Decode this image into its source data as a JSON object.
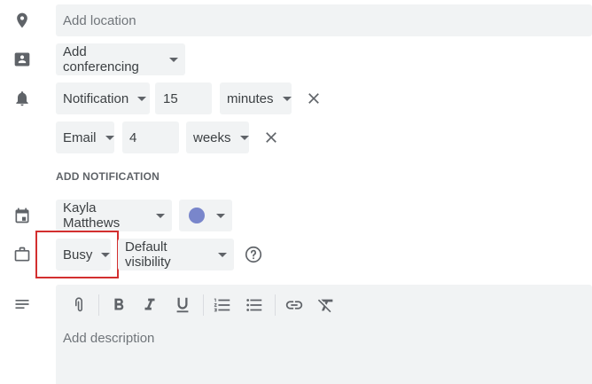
{
  "location": {
    "placeholder": "Add location"
  },
  "conferencing": {
    "label": "Add conferencing"
  },
  "notifications": [
    {
      "method": "Notification",
      "amount": "15",
      "unit": "minutes"
    },
    {
      "method": "Email",
      "amount": "4",
      "unit": "weeks"
    }
  ],
  "add_notification_label": "ADD NOTIFICATION",
  "calendar": {
    "owner": "Kayla Matthews",
    "color": "#7986cb"
  },
  "availability": {
    "status": "Busy",
    "visibility": "Default visibility"
  },
  "description": {
    "placeholder": "Add description",
    "toolbar": [
      "attach-icon",
      "bold-icon",
      "italic-icon",
      "underline-icon",
      "numbered-list-icon",
      "bulleted-list-icon",
      "link-icon",
      "clear-formatting-icon"
    ]
  },
  "highlight_color": "#d32f2f"
}
